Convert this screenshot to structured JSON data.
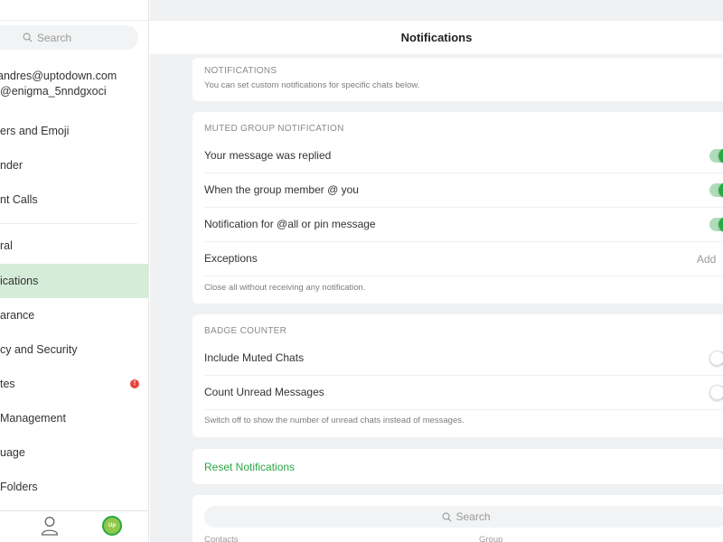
{
  "sidebar": {
    "search_placeholder": "Search",
    "account": {
      "email": "andres@uptodown.com",
      "username": "@enigma_5nndgxoci"
    },
    "items": [
      {
        "label": "ers and Emoji"
      },
      {
        "label": "nder"
      },
      {
        "label": "nt Calls"
      },
      {
        "label": "ral"
      },
      {
        "label": "ications",
        "active": true
      },
      {
        "label": "arance"
      },
      {
        "label": "cy and Security"
      },
      {
        "label": "tes",
        "badge": "!"
      },
      {
        "label": " Management"
      },
      {
        "label": "uage"
      },
      {
        "label": " Folders"
      }
    ],
    "avatar_text": "Up"
  },
  "header": {
    "title": "Notifications"
  },
  "notifications_section": {
    "title": "NOTIFICATIONS",
    "description": "You can set custom notifications for specific chats below."
  },
  "muted_group_section": {
    "title": "MUTED GROUP NOTIFICATION",
    "rows": [
      {
        "label": "Your message was replied",
        "toggle": "on"
      },
      {
        "label": "When the group member @ you",
        "toggle": "on"
      },
      {
        "label": "Notification for @all or pin message",
        "toggle": "on"
      }
    ],
    "exceptions_label": "Exceptions",
    "exceptions_action": "Add",
    "footer": "Close all without receiving any notification."
  },
  "badge_counter_section": {
    "title": "BADGE COUNTER",
    "rows": [
      {
        "label": "Include Muted Chats",
        "toggle": "off"
      },
      {
        "label": "Count Unread Messages",
        "toggle": "off"
      }
    ],
    "footer": "Switch off to show the number of unread chats instead of messages."
  },
  "reset": {
    "label": "Reset Notifications"
  },
  "exceptions_list": {
    "search_placeholder": "Search",
    "col_contacts": "Contacts",
    "col_group": "Group"
  },
  "colors": {
    "accent": "#2aa845",
    "active_bg": "#d5ecd9",
    "badge": "#e5443c"
  }
}
